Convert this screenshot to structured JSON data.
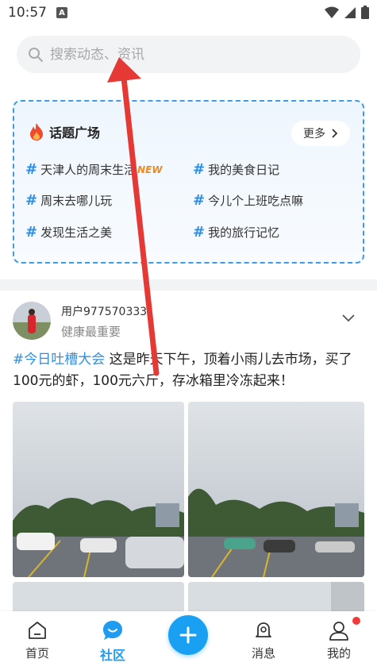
{
  "status_bar": {
    "time": "10:57",
    "notif_letter": "A"
  },
  "search": {
    "placeholder": "搜索动态、资讯"
  },
  "topics": {
    "title": "话题广场",
    "more_label": "更多",
    "items": [
      {
        "label": "天津人的周末生活",
        "badge": "NEW"
      },
      {
        "label": "我的美食日记"
      },
      {
        "label": "周末去哪儿玩"
      },
      {
        "label": "今儿个上班吃点嘛"
      },
      {
        "label": "发现生活之美"
      },
      {
        "label": "我的旅行记忆"
      }
    ]
  },
  "post": {
    "user_name": "用户977570333",
    "user_signature": "健康最重要",
    "tag": "#今日吐槽大会",
    "text": " 这是昨天下午，顶着小雨儿去市场，买了100元的虾，100元六斤，存冰箱里冷冻起来！"
  },
  "nav": {
    "items": [
      {
        "label": "首页"
      },
      {
        "label": "社区"
      },
      {
        "label": "消息"
      },
      {
        "label": "我的"
      }
    ]
  },
  "colors": {
    "accent": "#1f9bf0",
    "hashtag": "#2a8fe6",
    "new_badge": "#f08a1c",
    "arrow": "#e53935"
  }
}
